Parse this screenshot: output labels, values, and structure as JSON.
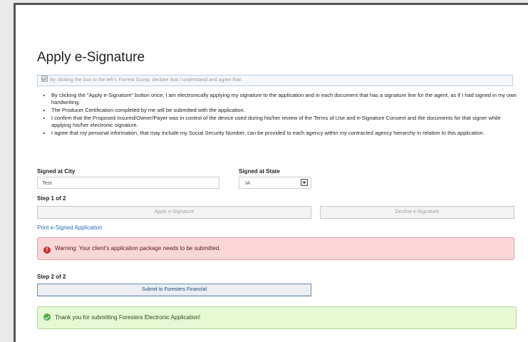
{
  "page": {
    "title": "Apply e-Signature",
    "agree_text": "By clicking the box to the left I, Forrest Gump, declare that I understand and agree that:",
    "terms": [
      "By clicking the \"Apply e-Signature\" button once, I am electronically applying my signature to the application and in each document that has a signature line for the agent, as if I had signed in my own handwriting.",
      "The Producer Certification completed by me will be submitted with the application.",
      "I confirm that the Proposed Insured/Owner/Payer was in control of the device used during his/her review of the Terms of Use and e-Signature Consent and the documents for that signer while applying his/her electronic signature.",
      "I agree that my personal information, that may include my Social Security Number, can be provided to each agency within my contracted agency hierarchy in relation to this application."
    ]
  },
  "form": {
    "city_label": "Signed at City",
    "city_value": "Test",
    "state_label": "Signed at State",
    "state_value": "IA"
  },
  "step1": {
    "label": "Step 1 of 2",
    "apply_button": "Apply e-Signature",
    "decline_button": "Decline e-Signature"
  },
  "print_link": "Print e-Signed Application",
  "warning": {
    "icon": "!",
    "text": "Warning: Your client's application package needs to be submitted."
  },
  "step2": {
    "label": "Step 2 of 2",
    "submit_button": "Submit to Foresters Financial"
  },
  "success": {
    "text": "Thank you for submitting Foresters Electronic Application!"
  },
  "colors": {
    "warning_bg": "#f9d7d9",
    "success_bg": "#e7f8d5",
    "link": "#2a6fb0"
  }
}
